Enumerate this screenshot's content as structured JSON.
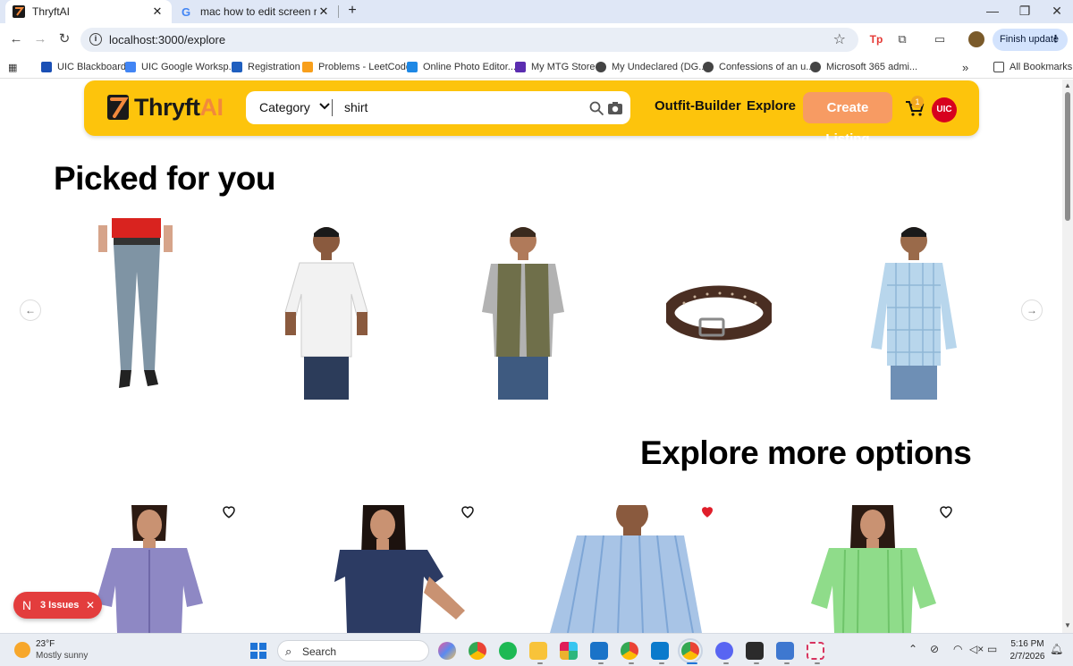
{
  "browser": {
    "tabs": [
      {
        "title": "ThryftAI",
        "active": true
      },
      {
        "title": "mac how to edit screen recordi",
        "active": false
      }
    ],
    "url": "localhost:3000/explore",
    "finish_update_label": "Finish update",
    "bookmarks": [
      {
        "label": "UIC Blackboard",
        "color": "#1a4fb5"
      },
      {
        "label": "UIC Google Worksp...",
        "color": "#4285f4"
      },
      {
        "label": "Registration",
        "color": "#1f5fbf"
      },
      {
        "label": "Problems - LeetCode",
        "color": "#f89f1b"
      },
      {
        "label": "Online Photo Editor...",
        "color": "#1e88e5"
      },
      {
        "label": "My MTG Store",
        "color": "#5b2db0"
      },
      {
        "label": "My Undeclared (DG...",
        "color": "#444444"
      },
      {
        "label": "Confessions of an u...",
        "color": "#444444"
      },
      {
        "label": "Microsoft 365 admi...",
        "color": "#444444"
      }
    ],
    "overflow_label": "»",
    "all_bookmarks_label": "All Bookmarks"
  },
  "site": {
    "logo_main": "Thryft",
    "logo_accent": "AI",
    "search": {
      "category_label": "Category",
      "query": "shirt"
    },
    "nav": {
      "outfit_builder": "Outfit-Builder",
      "explore": "Explore",
      "create_listing": "Create Listing"
    },
    "cart_count": "1",
    "avatar_text": "UIC",
    "brand_color": "#fdc40c",
    "accent_color": "#f79b63"
  },
  "picked": {
    "title": "Picked for you",
    "items": [
      {
        "name": "light-wash-jeans"
      },
      {
        "name": "white-short-sleeve-shirt"
      },
      {
        "name": "olive-vest-over-grey-tee"
      },
      {
        "name": "brown-leather-belt"
      },
      {
        "name": "light-blue-plaid-shirt"
      }
    ]
  },
  "explore": {
    "title": "Explore more options",
    "items": [
      {
        "name": "lavender-blouse",
        "favorited": false
      },
      {
        "name": "navy-top",
        "favorited": false
      },
      {
        "name": "blue-striped-shirt",
        "favorited": true
      },
      {
        "name": "green-striped-shirt",
        "favorited": false
      }
    ]
  },
  "dev_overlay": {
    "badge_letter": "N",
    "issues_label": "3 Issues"
  },
  "taskbar": {
    "weather_temp": "23°F",
    "weather_desc": "Mostly sunny",
    "search_placeholder": "Search",
    "time": "5:16 PM",
    "date": "2/7/2026"
  }
}
